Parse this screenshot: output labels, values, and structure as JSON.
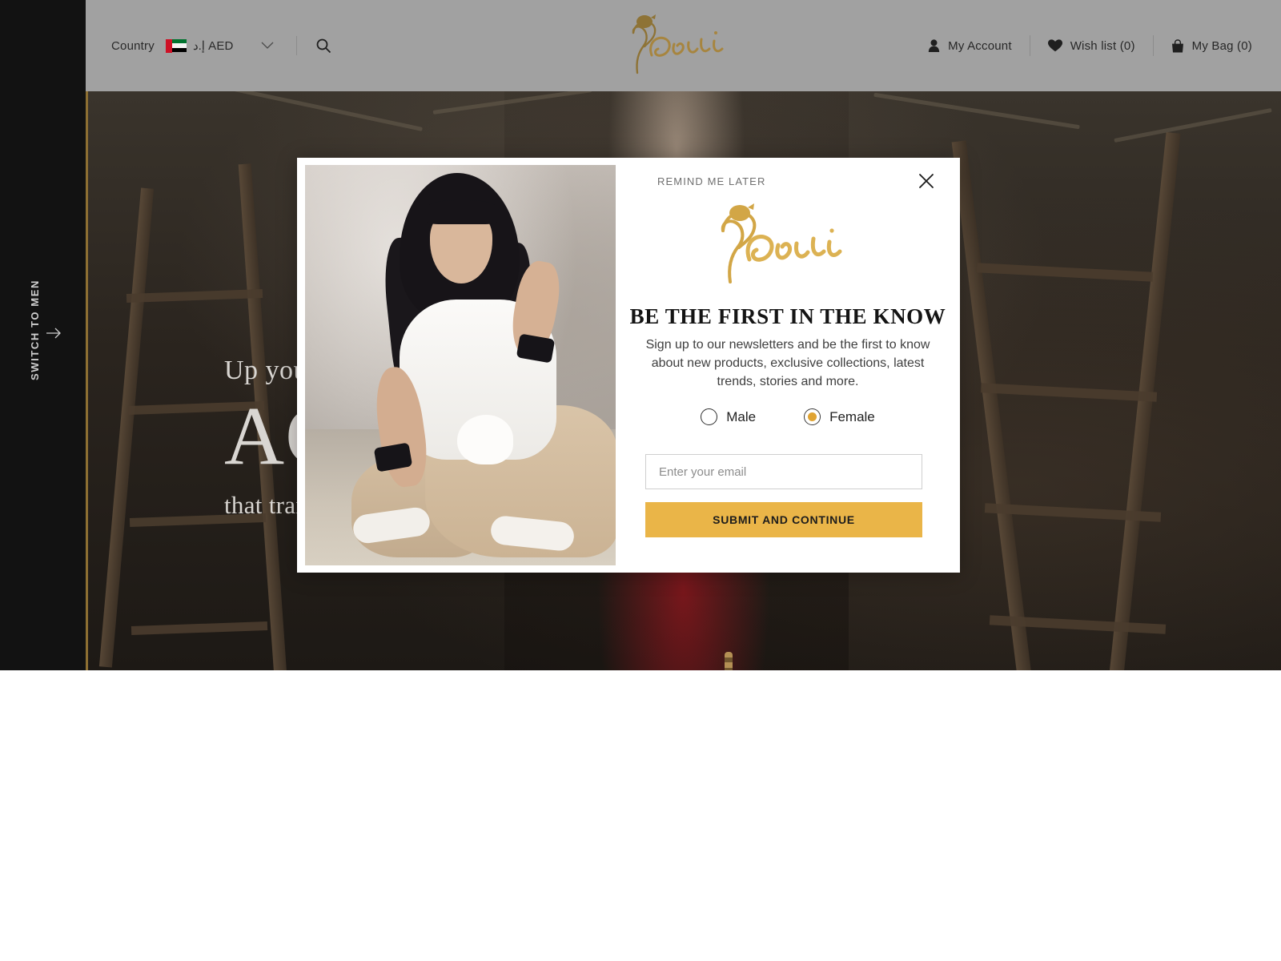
{
  "header": {
    "country_label": "Country",
    "flag_icon": "uae-flag-icon",
    "currency": "إ.د AED",
    "chevron_icon": "chevron-down-icon",
    "search_icon": "search-icon",
    "brand": "Coveti",
    "account": {
      "icon": "user-icon",
      "label": "My Account"
    },
    "wishlist": {
      "icon": "heart-icon",
      "label": "Wish list (0)"
    },
    "bag": {
      "icon": "bag-icon",
      "label": "My Bag (0)"
    }
  },
  "rail": {
    "switch_label": "SWITCH TO MEN",
    "arrow_icon": "arrow-right-icon"
  },
  "hero": {
    "line1": "Up you",
    "line2": "AC",
    "line3": "that tran"
  },
  "modal": {
    "remind_later": "REMIND ME LATER",
    "close_icon": "close-icon",
    "logo": "Coveti",
    "title": "BE THE FIRST IN THE KNOW",
    "subtitle": "Sign up to our newsletters and be the first to know about new products, exclusive collections, latest trends, stories and more.",
    "gender": {
      "male_label": "Male",
      "female_label": "Female",
      "selected": "Female"
    },
    "email_placeholder": "Enter your email",
    "email_value": "",
    "submit_label": "SUBMIT AND CONTINUE"
  },
  "colors": {
    "accent_gold": "#eab548",
    "brand_gold": "#c9a14a",
    "rail_gold_line": "#8d6f32",
    "header_gray": "#a1a1a1",
    "rail_black": "#121212"
  }
}
